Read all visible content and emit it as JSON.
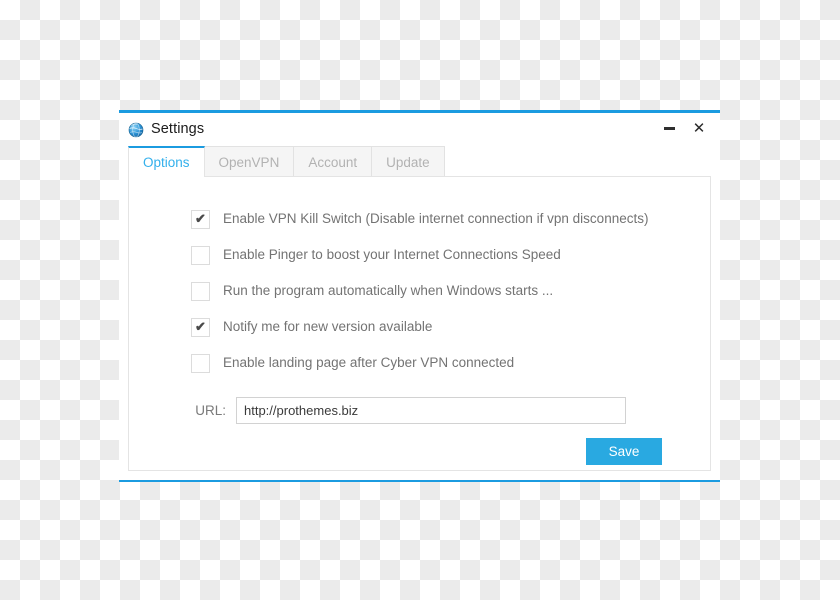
{
  "window": {
    "title": "Settings",
    "icon": "globe-icon",
    "accent_color": "#1b9be0",
    "controls": {
      "minimize_label": "−",
      "close_label": "✕"
    }
  },
  "tabs": [
    {
      "label": "Options",
      "active": true
    },
    {
      "label": "OpenVPN",
      "active": false
    },
    {
      "label": "Account",
      "active": false
    },
    {
      "label": "Update",
      "active": false
    }
  ],
  "options": [
    {
      "label": "Enable VPN Kill Switch (Disable internet connection if vpn disconnects)",
      "checked": true,
      "tick": "✔"
    },
    {
      "label": "Enable Pinger to boost your Internet Connections Speed",
      "checked": false,
      "tick": "✔"
    },
    {
      "label": "Run the program automatically when Windows starts ...",
      "checked": false,
      "tick": "✔"
    },
    {
      "label": "Notify me for new version available",
      "checked": true,
      "tick": "✔"
    },
    {
      "label": "Enable landing page after Cyber VPN connected",
      "checked": false,
      "tick": "✔"
    }
  ],
  "url_field": {
    "label": "URL:",
    "value": "http://prothemes.biz",
    "placeholder": "http://prothemes.biz"
  },
  "save": {
    "label": "Save",
    "color": "#29a9e1"
  }
}
